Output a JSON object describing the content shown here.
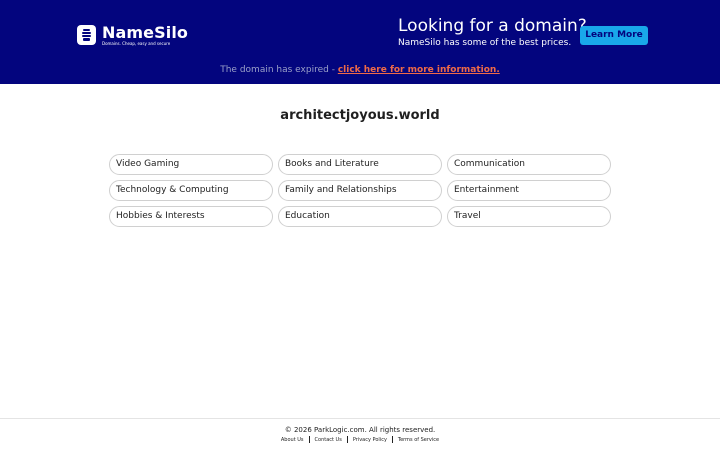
{
  "header": {
    "logo": {
      "name": "NameSilo",
      "tagline": "Domains. Cheap, easy and secure"
    },
    "promo_title": "Looking for a domain?",
    "promo_subtitle": "NameSilo has some of the best prices.",
    "learn_more_label": "Learn More",
    "expired_text": "The domain has expired - ",
    "expired_link": "click here for more information.",
    "colors": {
      "background": "#03057e",
      "button": "#19a8ea",
      "link": "#f06a47"
    }
  },
  "main": {
    "domain": "architectjoyous.world",
    "categories": [
      "Video Gaming",
      "Books and Literature",
      "Communication",
      "Technology & Computing",
      "Family and Relationships",
      "Entertainment",
      "Hobbies & Interests",
      "Education",
      "Travel"
    ]
  },
  "footer": {
    "copyright": "© 2026 ParkLogic.com. All rights reserved.",
    "links": [
      "About Us",
      "Contact Us",
      "Privacy Policy",
      "Terms of Service"
    ]
  }
}
